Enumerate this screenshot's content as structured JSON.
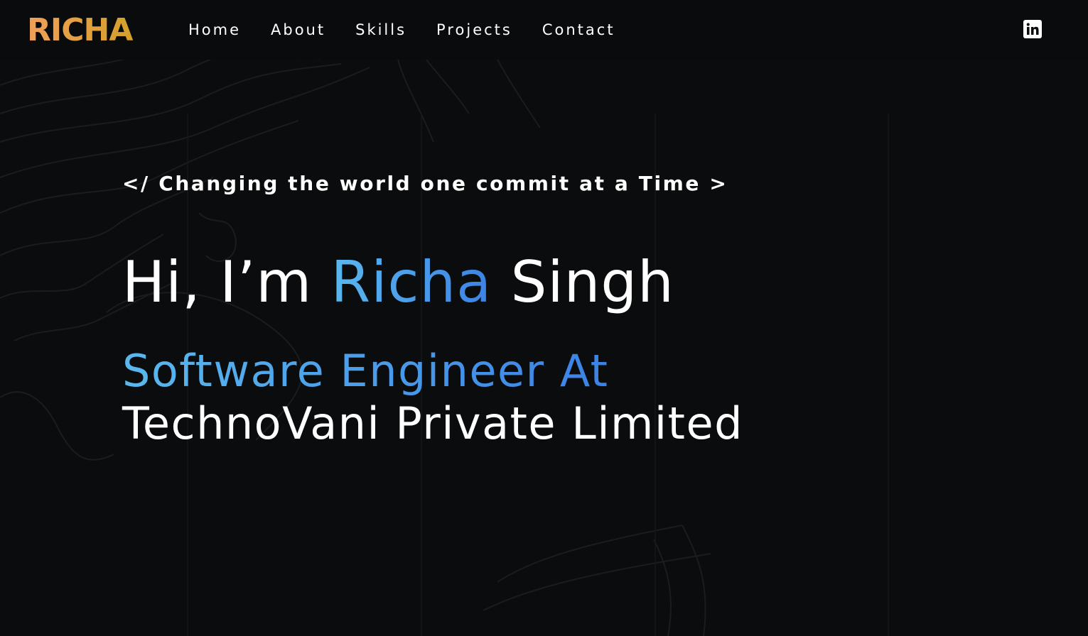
{
  "brand": {
    "logo_text": "RICHA",
    "logo_colors": [
      "#f0a05a",
      "#d4a02a"
    ]
  },
  "nav": {
    "items": [
      {
        "label": "Home"
      },
      {
        "label": "About"
      },
      {
        "label": "Skills"
      },
      {
        "label": "Projects"
      },
      {
        "label": "Contact"
      }
    ]
  },
  "social": {
    "icon": "linkedin-icon"
  },
  "hero": {
    "tagline": "</ Changing the world one commit at a Time >",
    "greeting": "Hi, I’m",
    "first_name": "Richa",
    "last_name": "Singh",
    "role": "Software Engineer At",
    "company": "TechnoVani Private Limited"
  },
  "colors": {
    "background": "#0b0c0d",
    "accent_start": "#5ab8ee",
    "accent_end": "#3b82e6",
    "text": "#ffffff"
  }
}
